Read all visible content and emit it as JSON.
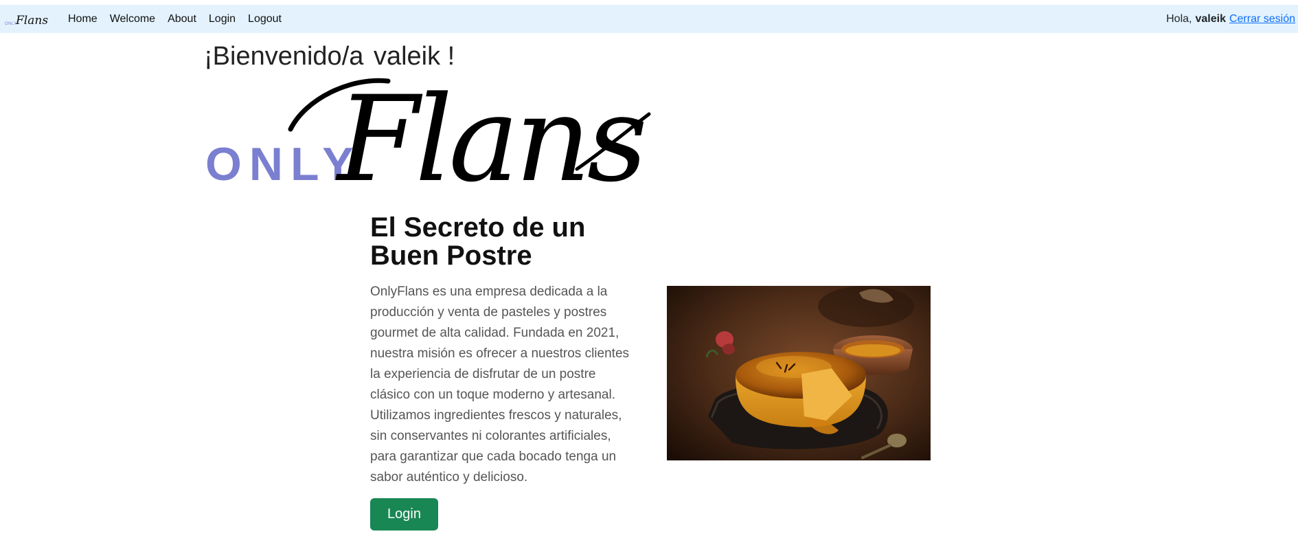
{
  "navbar": {
    "brand": {
      "only": "ONLY",
      "flans": "Flans"
    },
    "links": [
      "Home",
      "Welcome",
      "About",
      "Login",
      "Logout"
    ],
    "greeting": "Hola,",
    "username": "valeik",
    "logout_link": "Cerrar sesión"
  },
  "welcome": {
    "text": "¡Bienvenido/a",
    "username": "valeik",
    "suffix": "!"
  },
  "logo": {
    "only": "ONLY",
    "flans": "Flans",
    "only_color": "#7b7fd0"
  },
  "hero": {
    "title": "El Secreto de un Buen Postre",
    "description": "OnlyFlans es una empresa dedicada a la producción y venta de pasteles y postres gourmet de alta calidad. Fundada en 2021, nuestra misión es ofrecer a nuestros clientes la experiencia de disfrutar de un postre clásico con un toque moderno y artesanal. Utilizamos ingredientes frescos y naturales, sin conservantes ni colorantes artificiales, para garantizar que cada bocado tenga un sabor auténtico y delicioso.",
    "button_label": "Login",
    "button_color": "#198754"
  },
  "colors": {
    "navbar_bg": "#e3f2fd",
    "link": "#0d6efd"
  }
}
